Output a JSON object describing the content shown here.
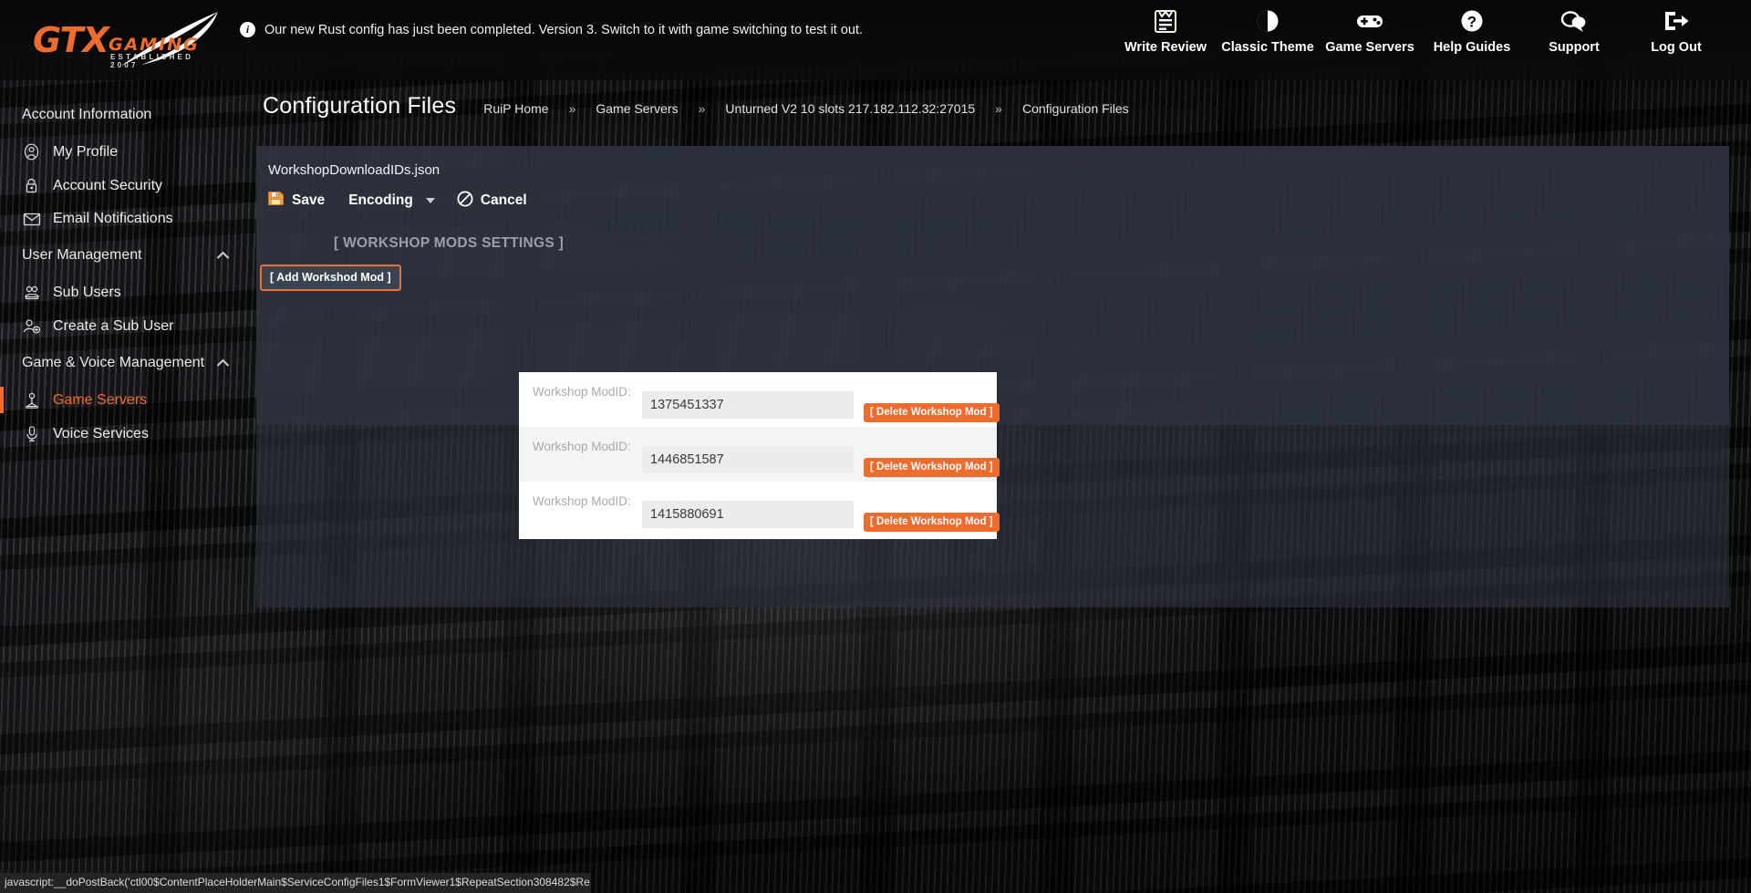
{
  "brand": {
    "name_primary": "GTX",
    "name_secondary": "GAMING",
    "tagline": "ESTABLISHED 2007",
    "accent": "#ee6c2e"
  },
  "notice": {
    "icon": "info-icon",
    "text": "Our new Rust config has just been completed. Version 3. Switch to it with game switching to test it out."
  },
  "topnav": [
    {
      "label": "Write Review",
      "icon": "clipboard-review-icon"
    },
    {
      "label": "Classic Theme",
      "icon": "contrast-circle-icon"
    },
    {
      "label": "Game Servers",
      "icon": "gamepad-icon"
    },
    {
      "label": "Help Guides",
      "icon": "question-circle-icon"
    },
    {
      "label": "Support",
      "icon": "chat-bubble-icon"
    },
    {
      "label": "Log Out",
      "icon": "logout-arrow-icon"
    }
  ],
  "sidebar": {
    "groups": [
      {
        "title": "Account Information",
        "collapsible": false,
        "items": [
          {
            "label": "My Profile",
            "icon": "user-circle-icon",
            "active": false
          },
          {
            "label": "Account Security",
            "icon": "lock-icon",
            "active": false
          },
          {
            "label": "Email Notifications",
            "icon": "envelope-icon",
            "active": false
          }
        ]
      },
      {
        "title": "User Management",
        "collapsible": true,
        "caret": "chevron-up-icon",
        "items": [
          {
            "label": "Sub Users",
            "icon": "users-icon",
            "active": false
          },
          {
            "label": "Create a Sub User",
            "icon": "user-plus-icon",
            "active": false
          }
        ]
      },
      {
        "title": "Game & Voice Management",
        "collapsible": true,
        "caret": "chevron-up-icon",
        "items": [
          {
            "label": "Game Servers",
            "icon": "server-joystick-icon",
            "active": true
          },
          {
            "label": "Voice Services",
            "icon": "microphone-icon",
            "active": false
          }
        ]
      }
    ]
  },
  "page": {
    "title": "Configuration Files",
    "breadcrumb": [
      "RuiP Home",
      "Game Servers",
      "Unturned V2 10 slots 217.182.112.32:27015",
      "Configuration Files"
    ],
    "breadcrumb_separator": "»"
  },
  "editor": {
    "filename": "WorkshopDownloadIDs.json",
    "toolbar": {
      "save_label": "Save",
      "save_icon": "floppy-disk-icon",
      "encoding_label": "Encoding",
      "encoding_caret": "chevron-down-icon",
      "cancel_label": "Cancel",
      "cancel_icon": "no-entry-icon"
    },
    "section_title": "[ WORKSHOP MODS SETTINGS ]",
    "add_button_label": "[ Add Workshod Mod ]",
    "row_label": "Workshop ModID:",
    "delete_button_label": "[ Delete Workshop Mod ]",
    "mods": [
      {
        "modid": "1375451337"
      },
      {
        "modid": "1446851587"
      },
      {
        "modid": "1415880691"
      }
    ]
  },
  "statusbar": {
    "text": "javascript:__doPostBack('ctl00$ContentPlaceHolderMain$ServiceConfigFiles1$FormViewer1$RepeatSection308482$Re..."
  }
}
